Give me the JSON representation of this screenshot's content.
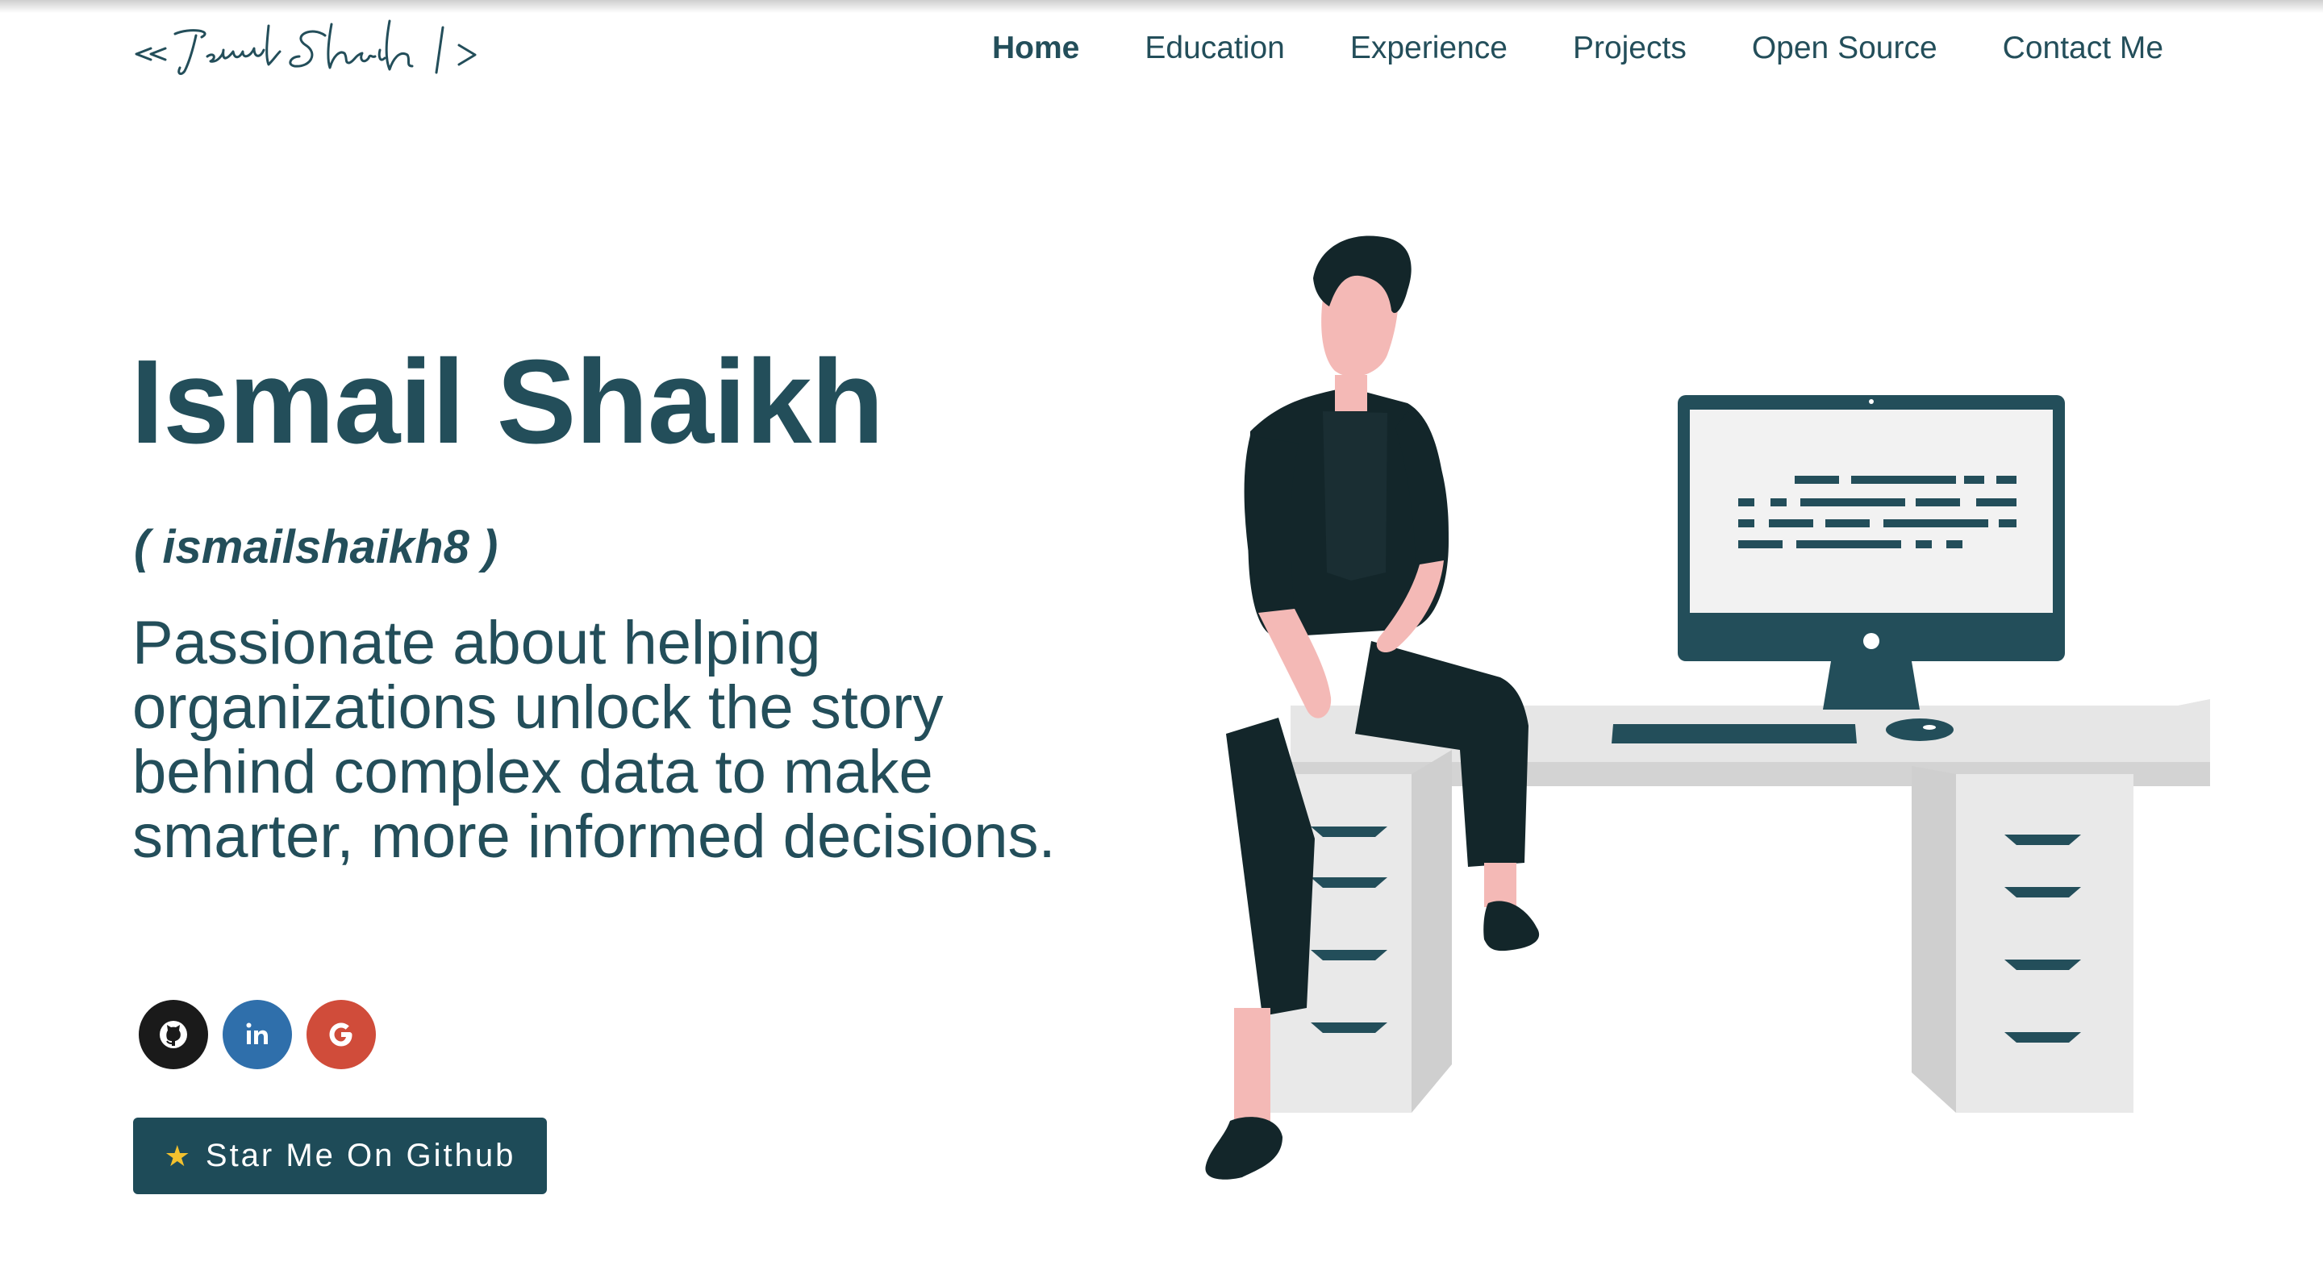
{
  "header": {
    "logo_text": "<< Ismail Shaikh />",
    "nav": [
      {
        "label": "Home",
        "active": true
      },
      {
        "label": "Education",
        "active": false
      },
      {
        "label": "Experience",
        "active": false
      },
      {
        "label": "Projects",
        "active": false
      },
      {
        "label": "Open Source",
        "active": false
      },
      {
        "label": "Contact Me",
        "active": false
      }
    ]
  },
  "hero": {
    "name": "Ismail Shaikh",
    "handle": "( ismailshaikh8 )",
    "tagline": "Passionate about helping organizations unlock the story behind complex data to make smarter, more informed decisions.",
    "socials": [
      {
        "icon": "github-icon",
        "color": "#1a1a1a"
      },
      {
        "icon": "linkedin-icon",
        "color": "#2f6fab"
      },
      {
        "icon": "google-icon",
        "color": "#d04c3a"
      }
    ],
    "cta": {
      "icon": "star-icon",
      "label": "Star Me On Github"
    }
  },
  "colors": {
    "primary": "#234e5a",
    "button_bg": "#1e4b58",
    "skin": "#f4b9b6",
    "desk": "#e6e6e6"
  }
}
